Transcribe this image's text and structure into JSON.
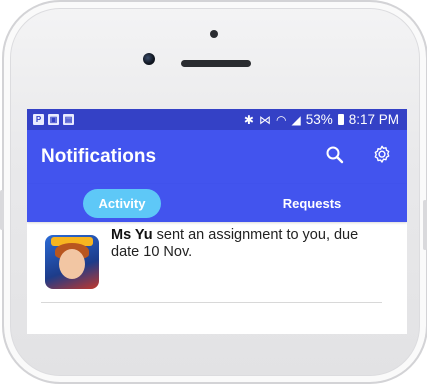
{
  "status_bar": {
    "battery": "53%",
    "time": "8:17 PM"
  },
  "app_bar": {
    "title": "Notifications"
  },
  "tabs": [
    {
      "label": "Activity",
      "active": true
    },
    {
      "label": "Requests",
      "active": false
    }
  ],
  "notifications": [
    {
      "sender": "Ms Yu",
      "message": " sent an assignment to you, due date 10 Nov."
    }
  ],
  "colors": {
    "status_bar": "#3441c6",
    "app_bar": "#4254ee",
    "active_tab": "#5ec8f7"
  }
}
